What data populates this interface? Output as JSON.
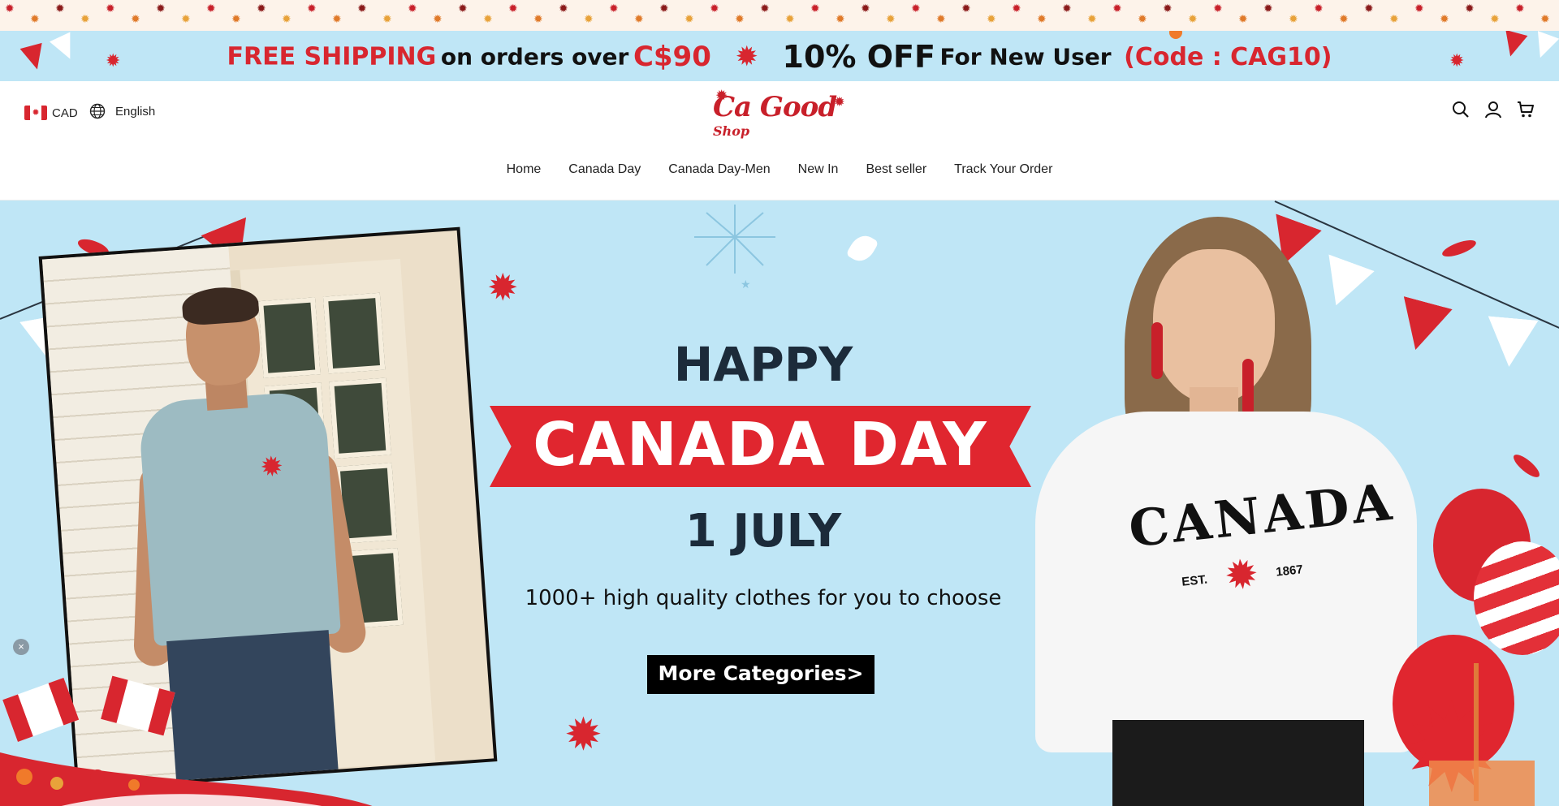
{
  "promo": {
    "free_shipping": "FREE SHIPPING",
    "on_orders": "on orders over",
    "threshold": "C$90",
    "discount": "10% OFF",
    "new_user": "For New User",
    "code": "(Code : CAG10)"
  },
  "header": {
    "currency": "CAD",
    "language": "English",
    "logo_main": "Ca Good",
    "logo_sub": "Shop"
  },
  "nav": {
    "items": [
      "Home",
      "Canada Day",
      "Canada Day-Men",
      "New In",
      "Best seller",
      "Track Your Order"
    ]
  },
  "hero": {
    "happy": "HAPPY",
    "canada_day": "CANADA DAY",
    "date": "1 JULY",
    "subtitle": "1000+ high quality clothes for you to choose",
    "cta": "More Categories>",
    "shirt_text": "CANADA",
    "shirt_est": "EST.",
    "shirt_year": "1867"
  },
  "colors": {
    "accent_red": "#d8262f",
    "sky_blue": "#bfe6f6",
    "dark_text": "#1c2b3a"
  }
}
